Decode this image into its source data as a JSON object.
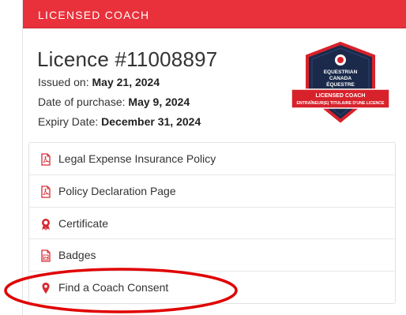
{
  "header": {
    "title": "LICENSED COACH"
  },
  "licence": {
    "number": "Licence #11008897",
    "issued_label": "Issued on:",
    "issued_value": "May 21, 2024",
    "purchase_label": "Date of purchase:",
    "purchase_value": "May 9, 2024",
    "expiry_label": "Expiry Date:",
    "expiry_value": "December 31, 2024"
  },
  "badge": {
    "lines": [
      "EQUESTRIAN",
      "CANADA",
      "ÉQUESTRE"
    ],
    "banner_line1": "LICENSED COACH",
    "banner_line2": "ENTRAÎNEUR(E) TITULAIRE D'UNE LICENCE"
  },
  "documents": [
    {
      "label": "Legal Expense Insurance Policy",
      "icon": "pdf-icon"
    },
    {
      "label": "Policy Declaration Page",
      "icon": "pdf-icon"
    },
    {
      "label": "Certificate",
      "icon": "award-ribbon-icon"
    },
    {
      "label": "Badges",
      "icon": "image-file-icon"
    },
    {
      "label": "Find a Coach Consent",
      "icon": "map-pin-icon"
    }
  ],
  "colors": {
    "accent": "#e8313b",
    "highlight_oval": "#e00000"
  }
}
